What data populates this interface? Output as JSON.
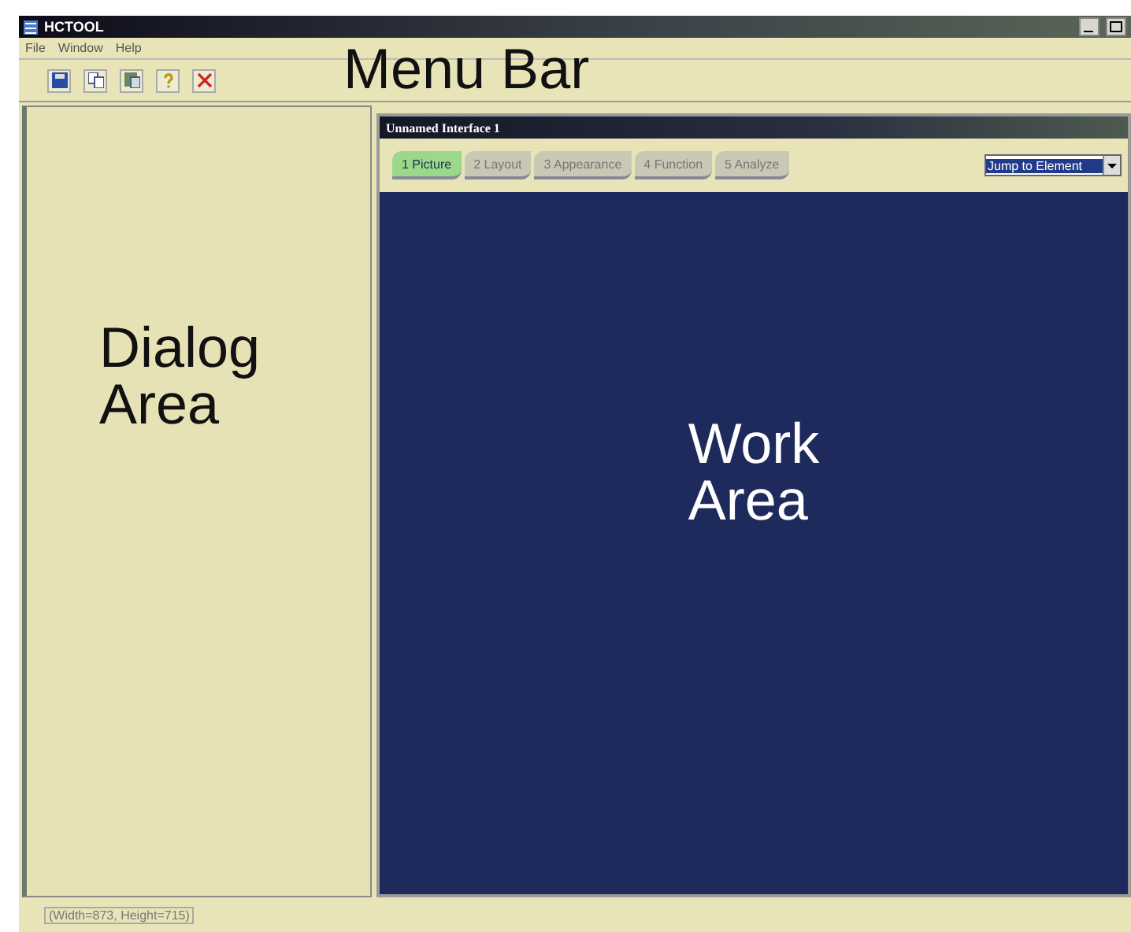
{
  "window": {
    "title": "HCTOOL"
  },
  "menu": [
    "File",
    "Window",
    "Help"
  ],
  "toolbar": [
    {
      "kind": "save"
    },
    {
      "kind": "copy"
    },
    {
      "kind": "paste"
    },
    {
      "kind": "help"
    },
    {
      "kind": "close"
    }
  ],
  "annotations": {
    "menu_bar": "Menu Bar",
    "dialog_area": "Dialog Area",
    "work_area": "Work Area"
  },
  "work_window": {
    "title": "Unnamed Interface 1",
    "tabs": [
      {
        "label": "1 Picture",
        "selected": true
      },
      {
        "label": "2 Layout",
        "selected": false
      },
      {
        "label": "3 Appearance",
        "selected": false
      },
      {
        "label": "4 Function",
        "selected": false
      },
      {
        "label": "5 Analyze",
        "selected": false
      }
    ],
    "jump": {
      "value": "Jump to Element"
    }
  },
  "status_bar": "(Width=873, Height=715)"
}
